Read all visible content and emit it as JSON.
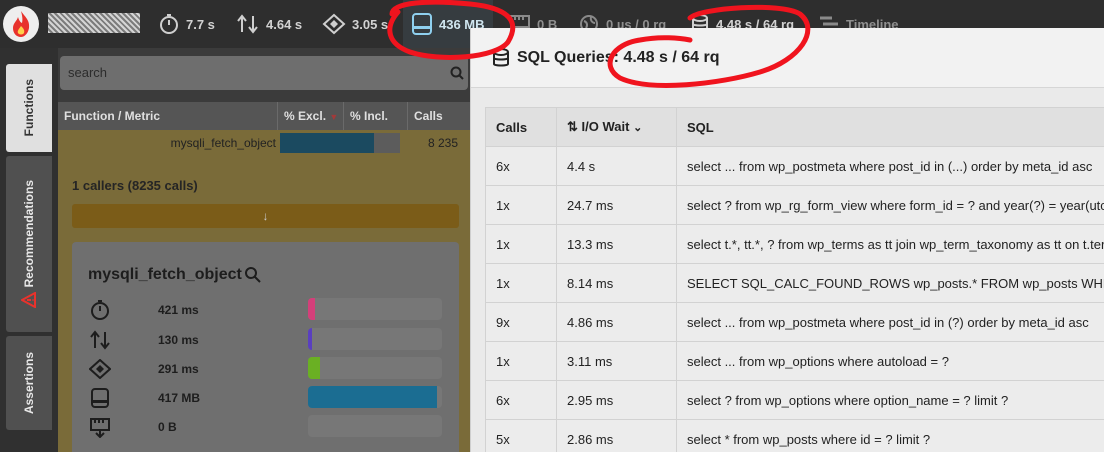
{
  "topbar": {
    "metrics": {
      "wall_time": "7.7 s",
      "io_wait": "4.64 s",
      "cpu": "3.05 s",
      "memory": "436 MB",
      "network": "0 B",
      "http": "0 µs / 0 rq",
      "sql": "4.48 s / 64 rq",
      "timeline": "Timeline"
    }
  },
  "side_tabs": {
    "functions": "Functions",
    "recommendations": "Recommendations",
    "assertions": "Assertions"
  },
  "functions": {
    "search_placeholder": "search",
    "columns": [
      "Function / Metric",
      "% Excl.",
      "% Incl.",
      "Calls"
    ],
    "row": {
      "name": "mysqli_fetch_object",
      "excl_fraction": 0.78,
      "calls": "8 235"
    },
    "callers": "1 callers (8235 calls)",
    "callers_arrow": "↓",
    "detail": {
      "title": "mysqli_fetch_object",
      "metrics": [
        {
          "icon": "stopwatch-icon",
          "value": "421 ms",
          "fraction": 0.05,
          "color": "#d43f7a"
        },
        {
          "icon": "updown-arrows-icon",
          "value": "130 ms",
          "fraction": 0.03,
          "color": "#5a3fc0"
        },
        {
          "icon": "cpu-chip-icon",
          "value": "291 ms",
          "fraction": 0.09,
          "color": "#6ab023"
        },
        {
          "icon": "memory-icon",
          "value": "417 MB",
          "fraction": 0.96,
          "color": "#1b6d92"
        },
        {
          "icon": "network-icon",
          "value": "0 B",
          "fraction": 0,
          "color": "#1b6d92"
        }
      ]
    }
  },
  "sql": {
    "title_prefix": "SQL Queries:",
    "title_value": "4.48 s / 64 rq",
    "columns": {
      "calls": "Calls",
      "io_wait": "I/O Wait",
      "sql": "SQL"
    },
    "rows": [
      {
        "calls": "6x",
        "wait": "4.4 s",
        "sql": "select ... from wp_postmeta where post_id in (...) order by meta_id asc"
      },
      {
        "calls": "1x",
        "wait": "24.7 ms",
        "sql": "select ? from wp_rg_form_view where form_id = ? and year(?) = year(utc_"
      },
      {
        "calls": "1x",
        "wait": "13.3 ms",
        "sql": "select t.*, tt.*, ? from wp_terms as tt join wp_term_taxonomy as tt on t.ter"
      },
      {
        "calls": "1x",
        "wait": "8.14 ms",
        "sql": "SELECT SQL_CALC_FOUND_ROWS wp_posts.* FROM wp_posts WHE"
      },
      {
        "calls": "9x",
        "wait": "4.86 ms",
        "sql": "select ... from wp_postmeta where post_id in (?) order by meta_id asc"
      },
      {
        "calls": "1x",
        "wait": "3.11 ms",
        "sql": "select ... from wp_options where autoload = ?"
      },
      {
        "calls": "6x",
        "wait": "2.95 ms",
        "sql": "select ? from wp_options where option_name = ? limit ?"
      },
      {
        "calls": "5x",
        "wait": "2.86 ms",
        "sql": "select * from wp_posts where id = ? limit ?"
      }
    ]
  },
  "colors": {
    "annotation_red": "#f0141e",
    "accent_blue": "#1b6d92",
    "function_row_yellow": "#f2d36b"
  }
}
